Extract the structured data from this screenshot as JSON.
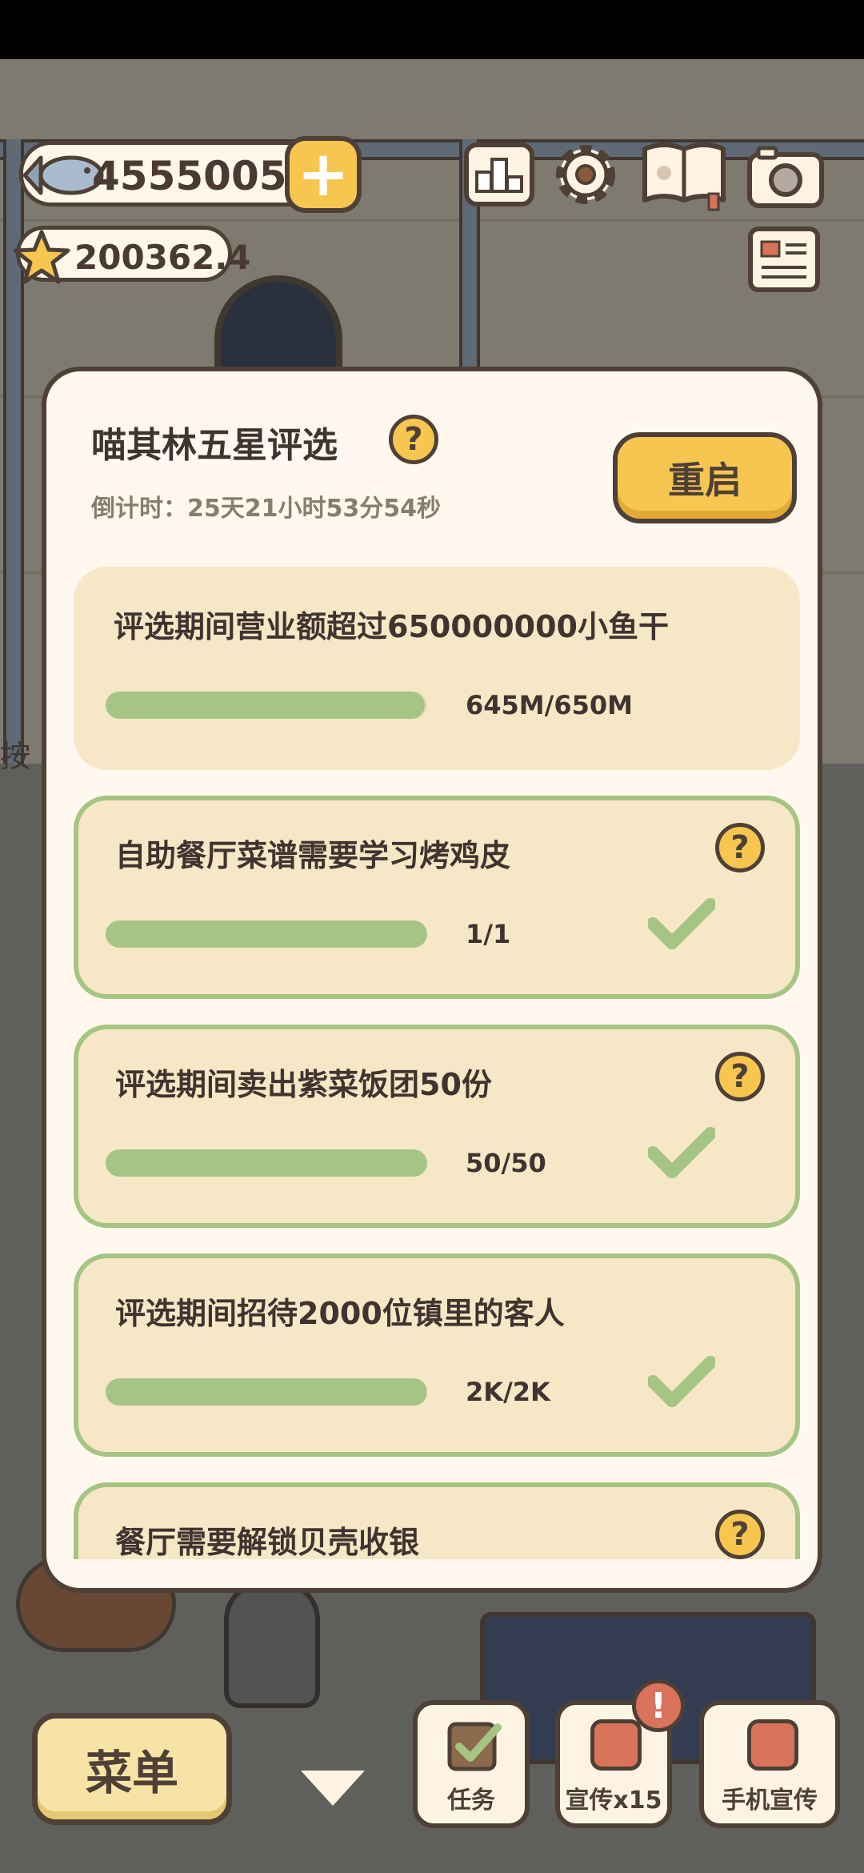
{
  "hud": {
    "fish_count": "4555005",
    "star_count": "200362.4",
    "plus_label": "+",
    "icons": [
      "fish-icon",
      "star-icon",
      "plus-icon",
      "ranking-icon",
      "settings-gear-icon",
      "paw-book-icon",
      "camera-icon",
      "newspaper-icon"
    ]
  },
  "modal": {
    "title": "喵其林五星评选",
    "help_glyph": "?",
    "countdown": "倒计时：25天21小时53分54秒",
    "restart_label": "重启",
    "tasks": [
      {
        "label": "评选期间营业额超过650000000小鱼干",
        "progress_text": "645M/650M",
        "progress": 0.992,
        "completed": false,
        "has_help": false
      },
      {
        "label": "自助餐厅菜谱需要学习烤鸡皮",
        "progress_text": "1/1",
        "progress": 1.0,
        "completed": true,
        "has_help": true
      },
      {
        "label": "评选期间卖出紫菜饭团50份",
        "progress_text": "50/50",
        "progress": 1.0,
        "completed": true,
        "has_help": true
      },
      {
        "label": "评选期间招待2000位镇里的客人",
        "progress_text": "2K/2K",
        "progress": 1.0,
        "completed": true,
        "has_help": false
      },
      {
        "label": "餐厅需要解锁贝壳收银",
        "completed": false,
        "has_help": true
      }
    ]
  },
  "background": {
    "side_text": "按"
  },
  "bottom": {
    "menu_label": "菜单",
    "task_label": "任务",
    "promo_label": "宣传x15",
    "phone_promo_label": "手机宣传",
    "alert_glyph": "!"
  },
  "colors": {
    "accent_yellow": "#f7c650",
    "panel": "#fff8ee",
    "task_bg": "#f6e7c6",
    "progress_green": "#a6c483",
    "outline": "#4e4036"
  }
}
